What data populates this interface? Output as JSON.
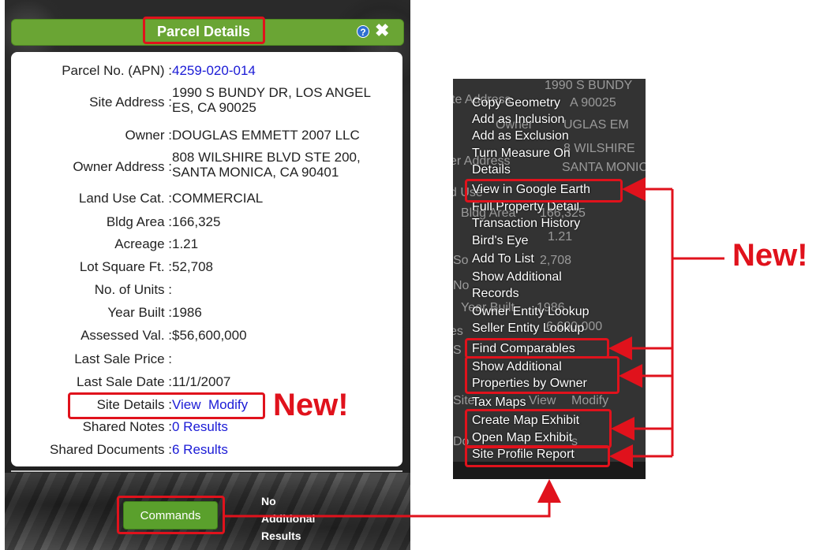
{
  "panel": {
    "title": "Parcel Details",
    "help_icon": "?",
    "close_icon": "✖",
    "fields": [
      {
        "label": "Parcel No. (APN) :",
        "value": "4259-020-014",
        "link": true
      },
      {
        "label": "Site Address :",
        "value": "1990 S BUNDY DR, LOS ANGEL ES, CA 90025"
      },
      {
        "label": "Owner :",
        "value": "DOUGLAS EMMETT 2007 LLC"
      },
      {
        "label": "Owner Address :",
        "value": "808 WILSHIRE BLVD STE 200, SANTA MONICA, CA 90401"
      },
      {
        "label": "Land Use Cat. :",
        "value": "COMMERCIAL"
      },
      {
        "label": "Bldg Area :",
        "value": "166,325"
      },
      {
        "label": "Acreage :",
        "value": "1.21"
      },
      {
        "label": "Lot Square Ft. :",
        "value": "52,708"
      },
      {
        "label": "No. of Units :",
        "value": ""
      },
      {
        "label": "Year Built :",
        "value": "1986"
      },
      {
        "label": "Assessed Val. :",
        "value": "$56,600,000"
      },
      {
        "label": "Last Sale Price :",
        "value": ""
      },
      {
        "label": "Last Sale Date :",
        "value": "11/1/2007"
      },
      {
        "label": "Site Details :",
        "value_view": "View",
        "value_modify": "Modify"
      },
      {
        "label": "Shared Notes :",
        "value": "0 Results",
        "link": true
      },
      {
        "label": "Shared Documents :",
        "value": "6 Results",
        "link": true
      }
    ],
    "address_line1": "1990 S BUNDY DR, LOS ANGEL",
    "address_line2": "ES, CA 90025",
    "owner_addr_line1": "808 WILSHIRE BLVD STE 200,",
    "owner_addr_line2": "SANTA MONICA, CA 90401",
    "commands_button": "Commands",
    "no_results_line1": "No",
    "no_results_line2": "Additional",
    "no_results_line3": "Results"
  },
  "annotations": {
    "new_label_left": "New!",
    "new_label_right": "New!",
    "highlight_color": "#e0121c"
  },
  "menu": {
    "items": [
      "Copy Geometry",
      "Add as Inclusion",
      "Add as Exclusion",
      "Turn Measure On",
      "Details",
      "View in Google Earth",
      "Full Property Detail",
      "Transaction History",
      "Bird's Eye",
      "Add To List",
      "Show Additional",
      "Records",
      "Owner Entity Lookup",
      "Seller Entity Lookup",
      "Find Comparables",
      "Show Additional",
      "Properties by Owner",
      "Tax Maps",
      "Create Map Exhibit",
      "Open Map Exhibit",
      "Site Profile Report"
    ],
    "background_text": [
      "1990 S BUNDY",
      "te Address",
      "A 90025",
      "Owner",
      "UGLAS EM",
      "er Address",
      "8 WILSHIRE",
      "SANTA MONIC",
      "d Use",
      "Bldg Area",
      "166,325",
      "1.21",
      "So",
      "2,708",
      "No",
      "Year Built",
      "1986",
      "es",
      "6,600,000",
      "S",
      "Site",
      "View",
      "Modify",
      "Do",
      "s"
    ]
  },
  "colors": {
    "green": "#6aa534",
    "link": "#1a1ad6",
    "menu_bg": "#333333"
  }
}
